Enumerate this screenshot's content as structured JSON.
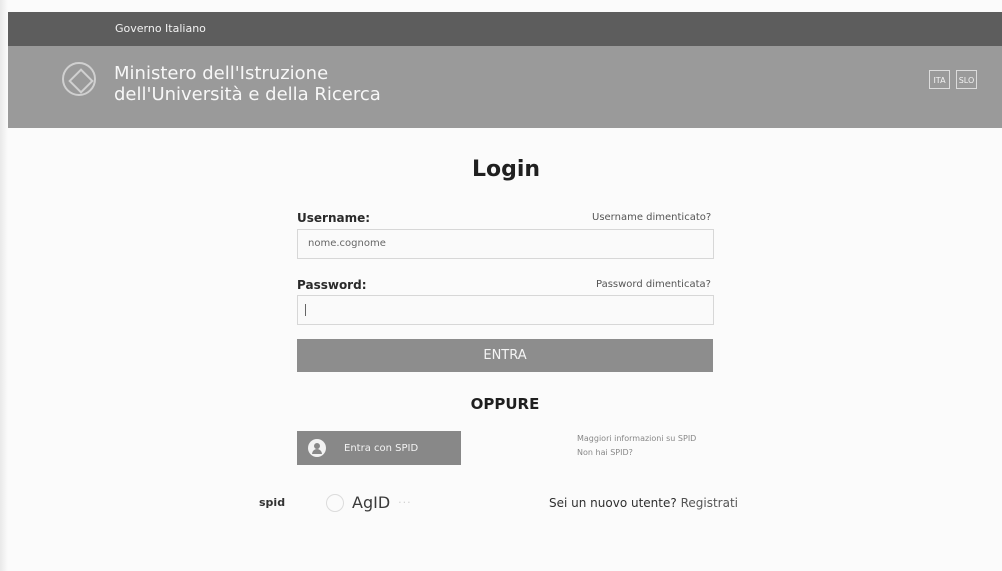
{
  "top_bar": {
    "label": "Governo Italiano"
  },
  "header": {
    "ministry_line_1": "Ministero dell'Istruzione",
    "ministry_line_2": "dell'Università e della Ricerca",
    "languages": [
      "ITA",
      "SLO"
    ]
  },
  "login": {
    "title": "Login",
    "username": {
      "label": "Username:",
      "forgot_link": "Username dimenticato?",
      "placeholder": "nome.cognome"
    },
    "password": {
      "label": "Password:",
      "forgot_link": "Password dimenticata?",
      "value": ""
    },
    "enter_button": "ENTRA",
    "or_text": "OPPURE",
    "spid": {
      "button": "Entra con SPID",
      "info_line_1": "Maggiori informazioni su SPID",
      "info_line_2": "Non hai SPID?"
    },
    "footer": {
      "spid_logo": "spid",
      "agid_logo": "AgID",
      "agid_suffix": "···",
      "new_user_text": "Sei un nuovo utente?",
      "register_link": "Registrati"
    }
  },
  "icons": {
    "emblem": "italian-republic-emblem-icon",
    "spid": "user-circle-icon",
    "agid": "agid-mark-icon"
  },
  "colors": {
    "top_bar": "#5d5d5d",
    "header": "#9a9a9a",
    "primary_button": "#8d8d8d",
    "spid_button": "#888888",
    "page_background": "#fbfbfb"
  }
}
